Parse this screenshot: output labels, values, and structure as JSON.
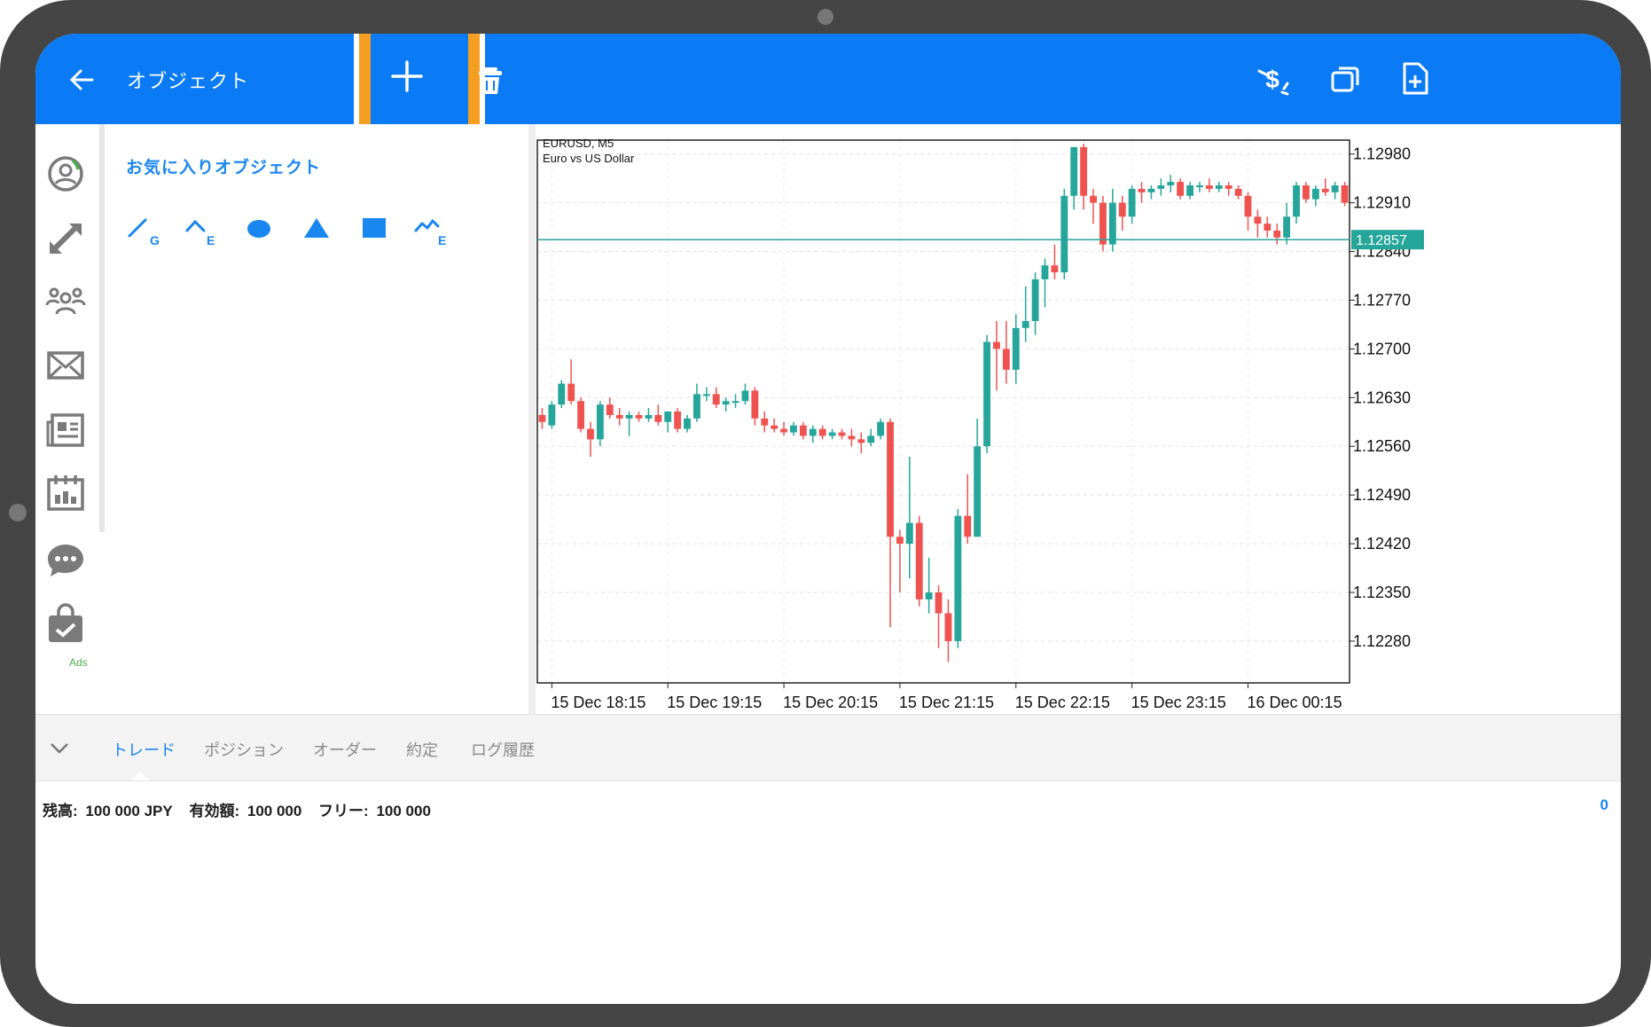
{
  "topbar": {
    "title": "オブジェクト",
    "icons": [
      "back-arrow-icon",
      "plus-icon",
      "trash-icon",
      "dollar-refresh-icon",
      "windows-icon",
      "add-document-icon"
    ],
    "color": "#0a7bf5",
    "highlight_color": "#f59f22"
  },
  "sidebar": {
    "items": [
      "account-icon",
      "trade-arrows-icon",
      "community-icon",
      "mail-icon",
      "news-icon",
      "calendar-icon",
      "chat-icon",
      "market-bag-icon"
    ],
    "ads_label": "Ads"
  },
  "objects": {
    "favorites_title": "お気に入りオブジェクト",
    "tools": [
      "trendline-tool-icon",
      "equidistant-channel-tool-icon",
      "ellipse-tool-icon",
      "triangle-tool-icon",
      "rectangle-tool-icon",
      "elliott-wave-tool-icon"
    ]
  },
  "chart_data": {
    "type": "candlestick",
    "symbol_line": "EURUSD, M5",
    "description": "Euro vs US Dollar",
    "current_price": "1.12857",
    "current_price_value": 1.12857,
    "y_ticks": [
      "1.12980",
      "1.12910",
      "1.12840",
      "1.12770",
      "1.12700",
      "1.12630",
      "1.12560",
      "1.12490",
      "1.12420",
      "1.12350",
      "1.12280"
    ],
    "y_tick_values": [
      1.1298,
      1.1291,
      1.1284,
      1.1277,
      1.127,
      1.1263,
      1.1256,
      1.1249,
      1.1242,
      1.1235,
      1.1228
    ],
    "x_ticks": [
      "15 Dec 18:15",
      "15 Dec 19:15",
      "15 Dec 20:15",
      "15 Dec 21:15",
      "15 Dec 22:15",
      "15 Dec 23:15",
      "16 Dec 00:15"
    ],
    "ylim": [
      1.1222,
      1.13
    ],
    "grid": true,
    "bull_color": "#26a69a",
    "bear_color": "#ef5350",
    "candles": [
      [
        1.12605,
        1.12615,
        1.12585,
        1.12595
      ],
      [
        1.1259,
        1.12625,
        1.12585,
        1.1262
      ],
      [
        1.1262,
        1.12655,
        1.12615,
        1.1265
      ],
      [
        1.1265,
        1.12685,
        1.1262,
        1.12625
      ],
      [
        1.12625,
        1.1263,
        1.1258,
        1.12585
      ],
      [
        1.12585,
        1.12595,
        1.12545,
        1.1257
      ],
      [
        1.1257,
        1.12625,
        1.1256,
        1.1262
      ],
      [
        1.1262,
        1.1263,
        1.126,
        1.12605
      ],
      [
        1.12605,
        1.12615,
        1.1259,
        1.126
      ],
      [
        1.126,
        1.1261,
        1.12575,
        1.12605
      ],
      [
        1.12605,
        1.1261,
        1.12595,
        1.126
      ],
      [
        1.126,
        1.12615,
        1.12595,
        1.12605
      ],
      [
        1.12605,
        1.1262,
        1.1259,
        1.12595
      ],
      [
        1.12595,
        1.1261,
        1.1258,
        1.1261
      ],
      [
        1.1261,
        1.12615,
        1.1258,
        1.12585
      ],
      [
        1.12585,
        1.12605,
        1.1258,
        1.126
      ],
      [
        1.126,
        1.1265,
        1.12595,
        1.12635
      ],
      [
        1.12635,
        1.12645,
        1.12625,
        1.12635
      ],
      [
        1.12635,
        1.12645,
        1.12615,
        1.1262
      ],
      [
        1.1262,
        1.1263,
        1.1261,
        1.12625
      ],
      [
        1.12625,
        1.12635,
        1.12615,
        1.12625
      ],
      [
        1.12625,
        1.1265,
        1.1262,
        1.1264
      ],
      [
        1.1264,
        1.12645,
        1.1259,
        1.126
      ],
      [
        1.126,
        1.1261,
        1.1258,
        1.1259
      ],
      [
        1.1259,
        1.126,
        1.1258,
        1.12585
      ],
      [
        1.12585,
        1.12595,
        1.12575,
        1.1258
      ],
      [
        1.1258,
        1.12595,
        1.12575,
        1.1259
      ],
      [
        1.1259,
        1.12595,
        1.1257,
        1.12575
      ],
      [
        1.12575,
        1.1259,
        1.12565,
        1.12585
      ],
      [
        1.12585,
        1.1259,
        1.1257,
        1.12575
      ],
      [
        1.12575,
        1.12585,
        1.1257,
        1.1258
      ],
      [
        1.1258,
        1.12585,
        1.1257,
        1.12575
      ],
      [
        1.12575,
        1.12585,
        1.1256,
        1.1257
      ],
      [
        1.1257,
        1.1258,
        1.1255,
        1.12565
      ],
      [
        1.12565,
        1.12585,
        1.1256,
        1.12575
      ],
      [
        1.12575,
        1.126,
        1.1257,
        1.12595
      ],
      [
        1.12595,
        1.126,
        1.123,
        1.1243
      ],
      [
        1.1243,
        1.1244,
        1.1235,
        1.1242
      ],
      [
        1.1242,
        1.12545,
        1.1237,
        1.1245
      ],
      [
        1.1245,
        1.1246,
        1.1233,
        1.1234
      ],
      [
        1.1234,
        1.124,
        1.1232,
        1.1235
      ],
      [
        1.1235,
        1.1236,
        1.1227,
        1.1232
      ],
      [
        1.1232,
        1.1234,
        1.1225,
        1.1228
      ],
      [
        1.1228,
        1.1247,
        1.1227,
        1.1246
      ],
      [
        1.1246,
        1.1252,
        1.1242,
        1.1243
      ],
      [
        1.1243,
        1.126,
        1.1243,
        1.1256
      ],
      [
        1.1256,
        1.1272,
        1.1255,
        1.1271
      ],
      [
        1.1271,
        1.1274,
        1.1264,
        1.127
      ],
      [
        1.127,
        1.1274,
        1.1265,
        1.1267
      ],
      [
        1.1267,
        1.1275,
        1.1265,
        1.1273
      ],
      [
        1.1273,
        1.1279,
        1.1271,
        1.1274
      ],
      [
        1.1274,
        1.1281,
        1.1272,
        1.128
      ],
      [
        1.128,
        1.1283,
        1.1276,
        1.1282
      ],
      [
        1.1282,
        1.1285,
        1.128,
        1.1281
      ],
      [
        1.1281,
        1.1293,
        1.128,
        1.1292
      ],
      [
        1.1292,
        1.1299,
        1.129,
        1.1299
      ],
      [
        1.1299,
        1.12995,
        1.129,
        1.1292
      ],
      [
        1.1292,
        1.1293,
        1.1288,
        1.1291
      ],
      [
        1.1291,
        1.1292,
        1.1284,
        1.1285
      ],
      [
        1.1285,
        1.1293,
        1.1284,
        1.1291
      ],
      [
        1.1291,
        1.1292,
        1.1287,
        1.1289
      ],
      [
        1.1289,
        1.12935,
        1.1288,
        1.1293
      ],
      [
        1.1293,
        1.1294,
        1.1291,
        1.12925
      ],
      [
        1.12925,
        1.12935,
        1.12915,
        1.1293
      ],
      [
        1.1293,
        1.12945,
        1.1292,
        1.12935
      ],
      [
        1.12935,
        1.1295,
        1.12925,
        1.1294
      ],
      [
        1.1294,
        1.12945,
        1.12915,
        1.1292
      ],
      [
        1.1292,
        1.1294,
        1.12915,
        1.12935
      ],
      [
        1.12935,
        1.1294,
        1.12925,
        1.12935
      ],
      [
        1.12935,
        1.12945,
        1.12925,
        1.1293
      ],
      [
        1.1293,
        1.1294,
        1.12925,
        1.12935
      ],
      [
        1.12935,
        1.1294,
        1.1292,
        1.1293
      ],
      [
        1.1293,
        1.12935,
        1.12915,
        1.1292
      ],
      [
        1.1292,
        1.12925,
        1.1287,
        1.1289
      ],
      [
        1.1289,
        1.129,
        1.1286,
        1.1288
      ],
      [
        1.1288,
        1.1289,
        1.1286,
        1.1287
      ],
      [
        1.1287,
        1.1288,
        1.1285,
        1.1286
      ],
      [
        1.1286,
        1.1291,
        1.1285,
        1.1289
      ],
      [
        1.1289,
        1.1294,
        1.1288,
        1.12935
      ],
      [
        1.12935,
        1.1294,
        1.1291,
        1.12915
      ],
      [
        1.12915,
        1.12935,
        1.12905,
        1.1293
      ],
      [
        1.1293,
        1.12945,
        1.1292,
        1.12925
      ],
      [
        1.12925,
        1.1294,
        1.12915,
        1.12935
      ],
      [
        1.12935,
        1.1294,
        1.12905,
        1.1291
      ]
    ]
  },
  "terminal": {
    "tabs": [
      "トレード",
      "ポジション",
      "オーダー",
      "約定",
      "ログ履歴"
    ],
    "balance_label": "残高:",
    "balance_value": "100 000 JPY",
    "equity_label": "有効額:",
    "equity_value": "100 000",
    "free_label": "フリー:",
    "free_value": "100 000",
    "profit": "0"
  }
}
